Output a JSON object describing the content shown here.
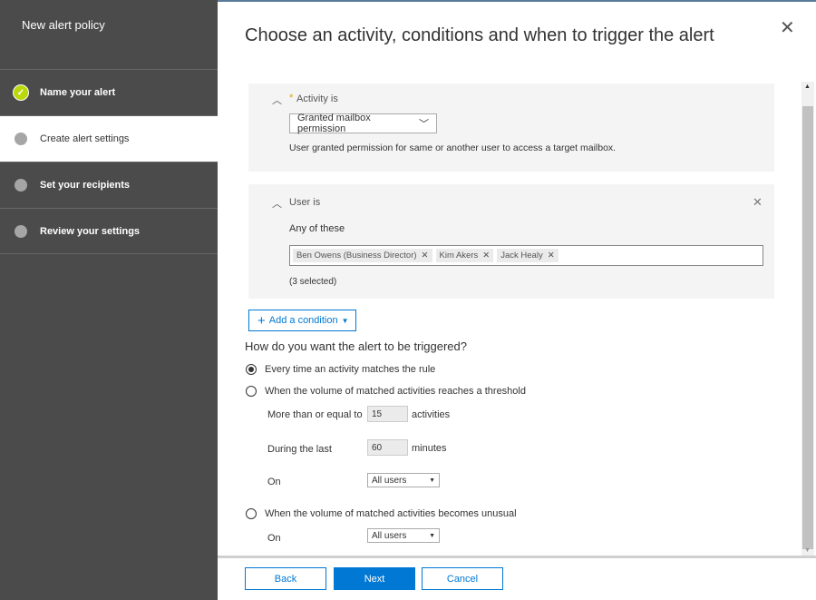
{
  "sidebar": {
    "title": "New alert policy",
    "steps": [
      {
        "label": "Name your alert",
        "state": "done"
      },
      {
        "label": "Create alert settings",
        "state": "current"
      },
      {
        "label": "Set your recipients",
        "state": "pending"
      },
      {
        "label": "Review your settings",
        "state": "pending"
      }
    ]
  },
  "main": {
    "title": "Choose an activity, conditions and when to trigger the alert",
    "activity": {
      "required_mark": "*",
      "label": "Activity is",
      "value": "Granted mailbox permission",
      "description": "User granted permission for same or another user to access a target mailbox."
    },
    "user": {
      "label": "User is",
      "sublabel": "Any of these",
      "tags": [
        "Ben Owens (Business Director)",
        "Kim Akers",
        "Jack Healy"
      ],
      "count": "(3 selected)"
    },
    "add_condition": "Add a condition",
    "trigger": {
      "question": "How do you want the alert to be triggered?",
      "option1": "Every time an activity matches the rule",
      "option2": "When the volume of matched activities reaches a threshold",
      "threshold_label": "More than or equal to",
      "threshold_value": "15",
      "threshold_unit": "activities",
      "during_label": "During the last",
      "during_value": "60",
      "during_unit": "minutes",
      "on_label": "On",
      "on_value": "All users",
      "option3": "When the volume of matched activities becomes unusual",
      "on2_label": "On",
      "on2_value": "All users",
      "selected": "option1"
    }
  },
  "footer": {
    "back": "Back",
    "next": "Next",
    "cancel": "Cancel"
  },
  "colors": {
    "accent": "#0078d4",
    "done": "#bad80a",
    "sidebar": "#4b4b4b"
  }
}
